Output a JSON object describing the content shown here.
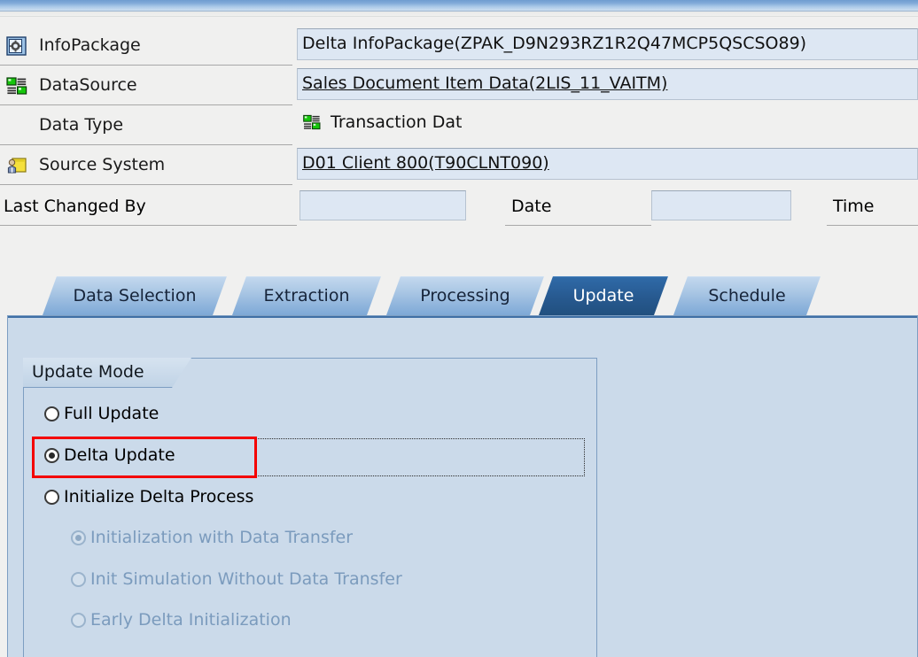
{
  "window": {
    "title_strip": ""
  },
  "header": {
    "rows": [
      {
        "label": "InfoPackage",
        "icon": "infopackage-icon",
        "value": "Delta InfoPackage(ZPAK_D9N293RZ1R2Q47MCP5QSCSO89)",
        "style": "input"
      },
      {
        "label": "DataSource",
        "icon": "datasource-icon",
        "value": "Sales Document Item Data(2LIS_11_VAITM)",
        "style": "link"
      },
      {
        "label": "Data Type",
        "icon": "",
        "value": "Transaction Dat",
        "value_icon": "datasource-icon",
        "style": "plain"
      },
      {
        "label": "Source System",
        "icon": "source-system-icon",
        "value": "D01 Client 800(T90CLNT090)",
        "style": "link"
      }
    ],
    "last_changed_by": {
      "label": "Last Changed By",
      "value": "",
      "placeholder": ""
    },
    "date": {
      "label": "Date",
      "value": "",
      "placeholder": ""
    },
    "time": {
      "label": "Time",
      "value": "",
      "placeholder": ""
    }
  },
  "tabs": [
    {
      "label": "Data Selection",
      "active": false
    },
    {
      "label": "Extraction",
      "active": false
    },
    {
      "label": "Processing",
      "active": false
    },
    {
      "label": "Update",
      "active": true
    },
    {
      "label": "Schedule",
      "active": false
    }
  ],
  "update_tab": {
    "group_title": "Update Mode",
    "options": [
      {
        "label": "Full Update",
        "selected": false,
        "disabled": false,
        "indent": 0
      },
      {
        "label": "Delta Update",
        "selected": true,
        "disabled": false,
        "indent": 0,
        "highlighted": true,
        "focused": true
      },
      {
        "label": "Initialize Delta Process",
        "selected": false,
        "disabled": false,
        "indent": 0
      },
      {
        "label": "Initialization with Data Transfer",
        "selected": true,
        "disabled": true,
        "indent": 1
      },
      {
        "label": "Init Simulation Without Data Transfer",
        "selected": false,
        "disabled": true,
        "indent": 1
      },
      {
        "label": "Early Delta Initialization",
        "selected": false,
        "disabled": true,
        "indent": 1
      }
    ]
  },
  "colors": {
    "annotation_red": "#f40000",
    "panel_blue": "#cbdaea",
    "active_tab_blue": "#27598f",
    "field_blue": "#dde7f3",
    "disabled_text": "#7b9bbd"
  }
}
